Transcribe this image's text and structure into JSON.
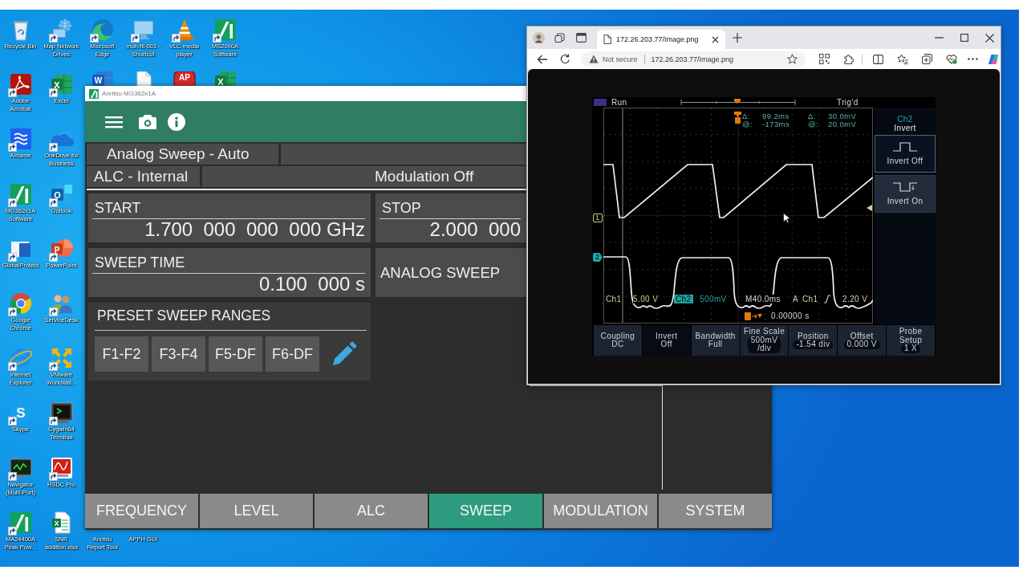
{
  "desktop": {
    "icons": [
      {
        "label": "Recycle Bin",
        "kind": "recycle",
        "shortcut": false
      },
      {
        "label": "Adobe Acrobat",
        "kind": "acrobat",
        "shortcut": true
      },
      {
        "label": "Airtame",
        "kind": "airtame",
        "shortcut": true
      },
      {
        "label": "MG362x1A Software",
        "kind": "anritsu",
        "shortcut": true
      },
      {
        "label": "GlobalProtect",
        "kind": "globalprotect",
        "shortcut": true
      },
      {
        "label": "Google Chrome",
        "kind": "chrome",
        "shortcut": true
      },
      {
        "label": "Internet Explorer",
        "kind": "ie",
        "shortcut": true
      },
      {
        "label": "Skype",
        "kind": "skype",
        "glyph": "S",
        "shortcut": true
      },
      {
        "label": "Navigator (Multi-Port)",
        "kind": "navigator",
        "shortcut": true
      },
      {
        "label": "MA24400A Peak Pow...",
        "kind": "anritsu",
        "shortcut": true
      },
      {
        "label": "Map Network Drives",
        "kind": "network",
        "shortcut": true
      },
      {
        "label": "Excel",
        "kind": "excel",
        "glyph": "X",
        "shortcut": true
      },
      {
        "label": "OneDrive for Business",
        "kind": "onedrive",
        "shortcut": true
      },
      {
        "label": "Outlook",
        "kind": "outlook",
        "glyph": "O",
        "shortcut": true
      },
      {
        "label": "PowerPoint",
        "kind": "powerpoint",
        "glyph": "P",
        "shortcut": true
      },
      {
        "label": "ServiceDesk",
        "kind": "people",
        "shortcut": true
      },
      {
        "label": "VMware Workstati...",
        "kind": "vmware",
        "shortcut": true
      },
      {
        "label": "Cygwin64 Terminal",
        "kind": "terminal",
        "shortcut": true
      },
      {
        "label": "HSDC Pro",
        "kind": "hsdc",
        "shortcut": true
      },
      {
        "label": "SNR addition.xlsx",
        "kind": "sheet",
        "glyph": "X",
        "shortcut": false
      }
    ],
    "top_row": [
      {
        "label": "Microsoft Edge",
        "kind": "edge",
        "shortcut": true
      },
      {
        "label": "moh-fil-003 - Shortcut",
        "kind": "computer",
        "shortcut": true
      },
      {
        "label": "VLC media player",
        "kind": "vlc",
        "shortcut": true
      },
      {
        "label": "MS2090A Software",
        "kind": "anritsu",
        "shortcut": true
      }
    ],
    "partly_covered": [
      {
        "kind": "word",
        "glyph": "W"
      },
      {
        "kind": "file"
      },
      {
        "kind": "apsig",
        "glyph": "AP"
      },
      {
        "kind": "excel",
        "glyph": "X"
      }
    ],
    "bottom_row": [
      {
        "label": "Anritsu Report Tool"
      },
      {
        "label": "APPH GUI"
      }
    ]
  },
  "app": {
    "title": "Anritsu MG362x1A",
    "status": {
      "sweep_mode": "Analog Sweep - Auto",
      "alc": "ALC - Internal",
      "modulation": "Modulation Off"
    },
    "panels": [
      {
        "kind": "entry",
        "label": "START",
        "value": "1.700  000  000  000 GHz"
      },
      {
        "kind": "entry",
        "label": "STOP",
        "value": "2.000  000"
      },
      {
        "kind": "entry",
        "label": "SWEEP TIME",
        "value": "0.100  000 s"
      },
      {
        "kind": "action",
        "label": "ANALOG SWEEP"
      }
    ],
    "preset_ranges": {
      "title": "PRESET SWEEP RANGES",
      "buttons": [
        "F1-F2",
        "F3-F4",
        "F5-DF",
        "F6-DF"
      ]
    },
    "nav_tabs": [
      {
        "label": "FREQUENCY",
        "selected": false
      },
      {
        "label": "LEVEL",
        "selected": false
      },
      {
        "label": "ALC",
        "selected": false
      },
      {
        "label": "SWEEP",
        "selected": true
      },
      {
        "label": "MODULATION",
        "selected": false
      },
      {
        "label": "SYSTEM",
        "selected": false
      }
    ]
  },
  "browser": {
    "tabs": [
      {
        "title": "172.26.203.77/Image.png",
        "selected": true
      }
    ],
    "address_bar": {
      "security_label": "Not secure",
      "url": "172.26.203.77/Image.png"
    },
    "scope": {
      "acquisition_state": "Run",
      "trigger_status": "Trig'd",
      "cursor_readouts": [
        {
          "time_label": "Δ:",
          "time": "99.2ms",
          "voltage_label": "Δ:",
          "voltage": "30.0mV"
        },
        {
          "time_label": "@:",
          "time": "-173ms",
          "voltage_label": "@:",
          "voltage": "20.0mV"
        }
      ],
      "channels": [
        {
          "name": "Ch1",
          "marker": "1",
          "scale": "5.00 V",
          "color": "#d8cf8a",
          "selected": false
        },
        {
          "name": "Ch2",
          "marker": "2",
          "scale": "500mV",
          "color": "#1fa5a3",
          "selected": true
        }
      ],
      "timebase": "M40.0ms",
      "trigger": {
        "mode": "A",
        "source": "Ch1",
        "level": "2.20 V"
      },
      "trigger_position": "0.00000 s",
      "side_menu": {
        "channel": "Ch2",
        "title": "Invert",
        "options": [
          {
            "label": "Invert Off",
            "kind": "normal",
            "selected": true
          },
          {
            "label": "Invert On",
            "kind": "inverted",
            "selected": false
          }
        ]
      },
      "bottom_menu": [
        {
          "title": "Coupling",
          "value": "DC",
          "kind": "plain",
          "selected": false
        },
        {
          "title": "Invert",
          "value": "Off",
          "kind": "plain",
          "selected": true
        },
        {
          "title": "Bandwidth",
          "value": "Full",
          "kind": "plain",
          "selected": false
        },
        {
          "title": "Fine Scale",
          "value": "500mV\n/div",
          "kind": "knob",
          "selected": false
        },
        {
          "title": "Position",
          "value": "-1.54 div",
          "kind": "knob",
          "selected": false
        },
        {
          "title": "Offset",
          "value": "0.000 V",
          "kind": "knob",
          "selected": false
        },
        {
          "title": "Probe Setup",
          "value": "1 X",
          "kind": "knob",
          "selected": false
        }
      ]
    }
  }
}
